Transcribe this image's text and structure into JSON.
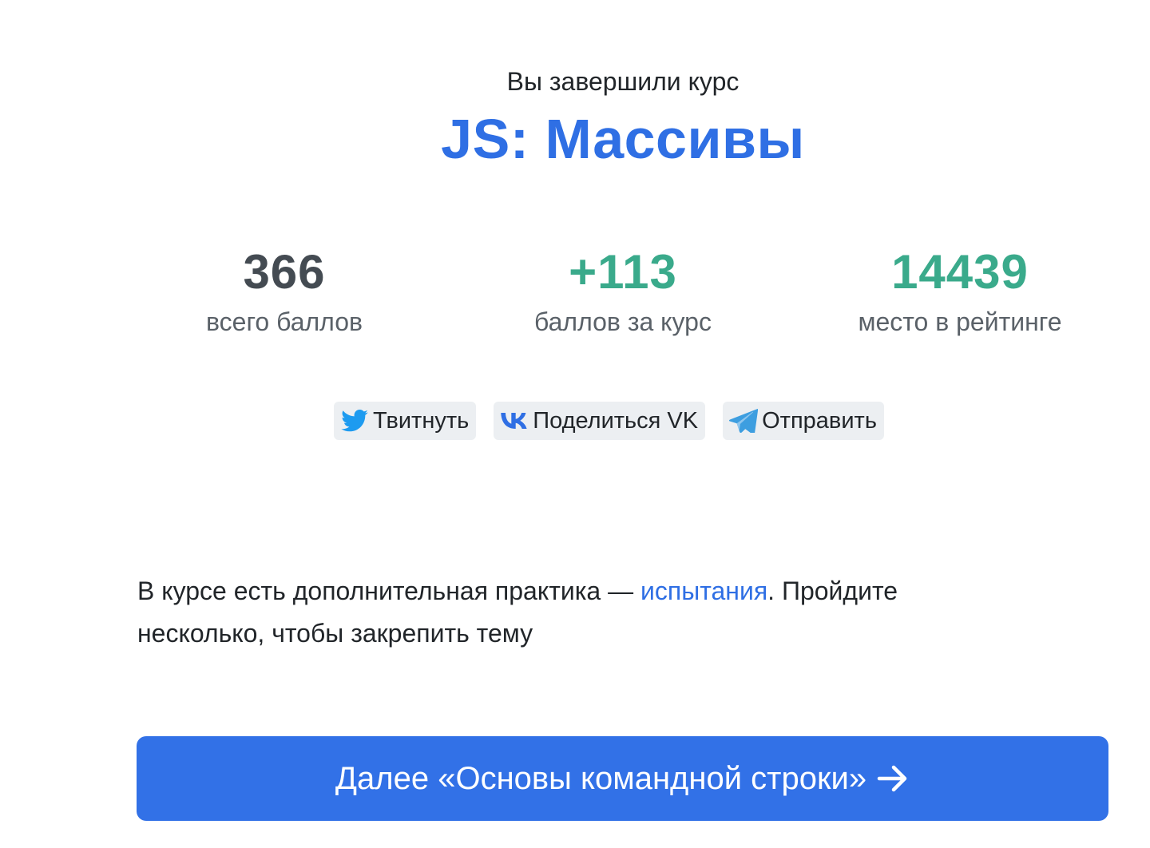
{
  "header": {
    "completed_label": "Вы завершили курс",
    "course_title": "JS: Массивы"
  },
  "stats": {
    "total_points_value": "366",
    "total_points_label": "всего баллов",
    "course_points_value": "+113",
    "course_points_label": "баллов за курс",
    "rank_value": "14439",
    "rank_label": "место в рейтинге"
  },
  "share": {
    "twitter_label": "Твитнуть",
    "twitter_icon": "twitter-bird-icon",
    "vk_label": "Поделиться VK",
    "vk_icon": "vk-logo-icon",
    "telegram_label": "Отправить",
    "telegram_icon": "telegram-plane-icon"
  },
  "practice": {
    "text_before": "В курсе есть дополнительная практика — ",
    "link_label": "испытания",
    "text_after": ". Пройдите несколько, чтобы закрепить тему"
  },
  "next": {
    "label": "Далее «Основы командной строки»",
    "icon": "arrow-right-icon"
  },
  "colors": {
    "accent_blue": "#2f6fe4",
    "button_blue": "#3271e7",
    "stat_green": "#3aaa8b",
    "stat_dark": "#444b52",
    "share_bg": "#eceff2"
  }
}
